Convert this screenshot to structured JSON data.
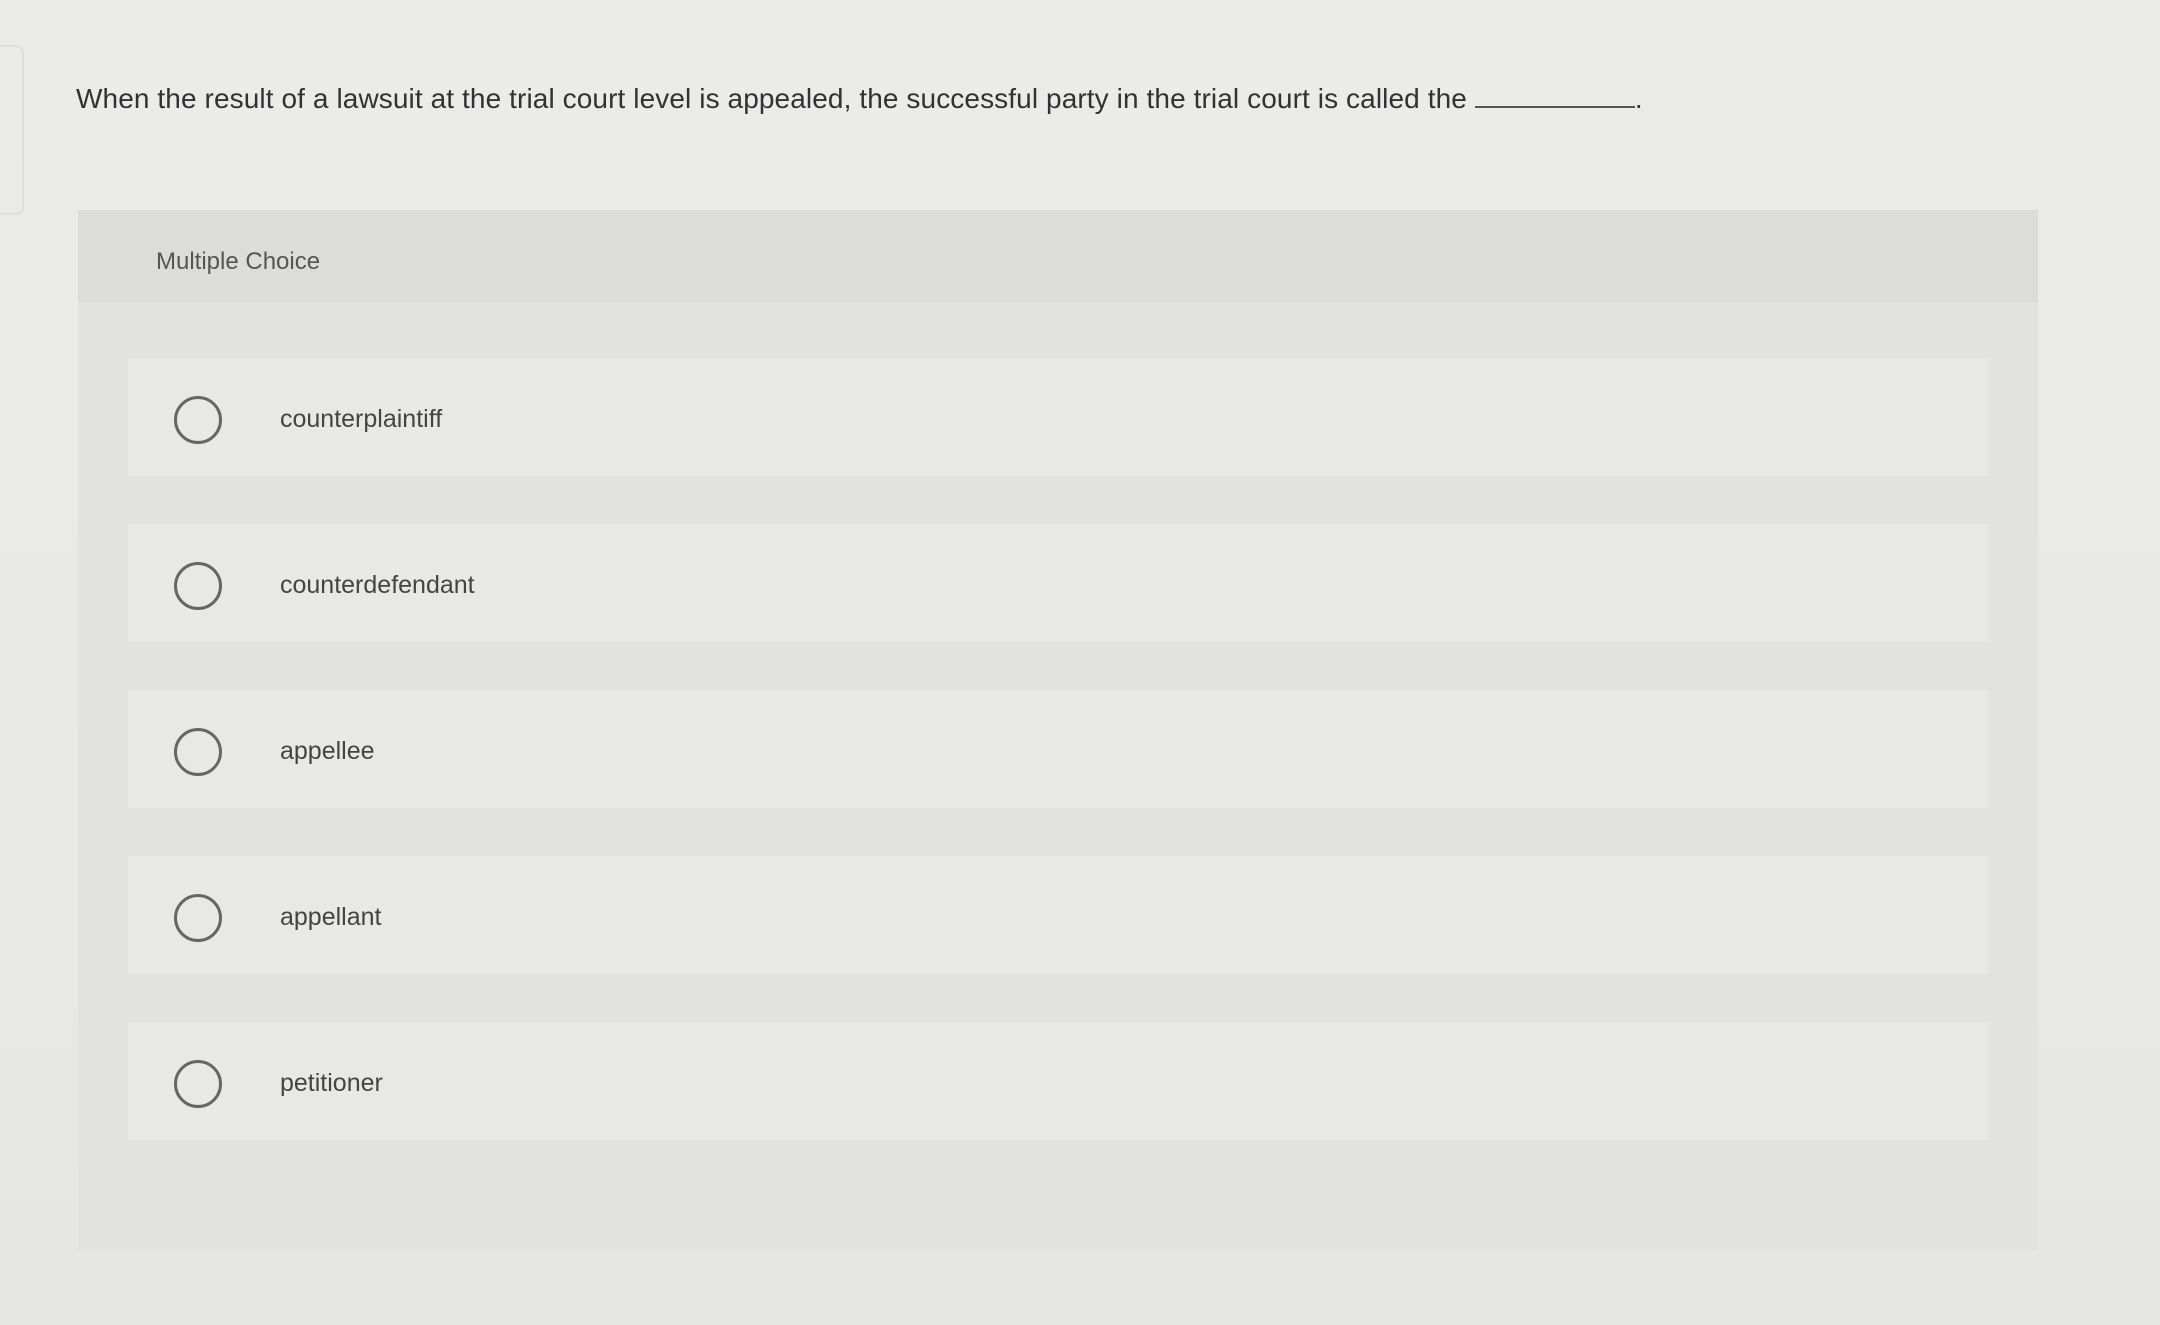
{
  "question": {
    "text": "When the result of a lawsuit at the trial court level is appealed, the successful party in the trial court is called the",
    "blank_suffix": "."
  },
  "multiple_choice": {
    "title": "Multiple Choice",
    "options": [
      {
        "label": "counterplaintiff",
        "selected": false
      },
      {
        "label": "counterdefendant",
        "selected": false
      },
      {
        "label": "appellee",
        "selected": false
      },
      {
        "label": "appellant",
        "selected": false
      },
      {
        "label": "petitioner",
        "selected": false
      }
    ]
  }
}
